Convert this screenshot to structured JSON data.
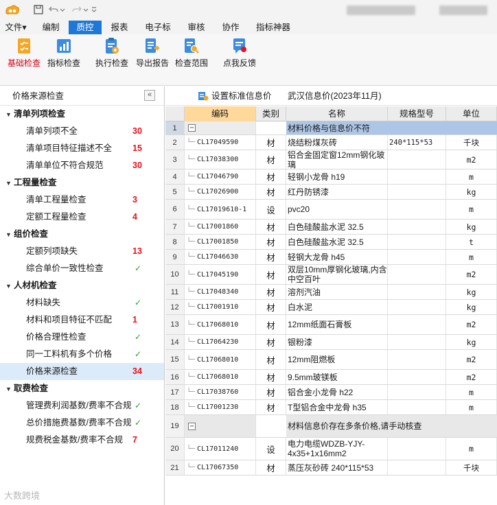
{
  "menu": {
    "items": [
      "文件▾",
      "编制",
      "质控",
      "报表",
      "电子标",
      "审核",
      "协作",
      "指标神器"
    ],
    "active_index": 2
  },
  "ribbon": {
    "buttons": [
      {
        "label": "基础检查",
        "icon": "checklist-icon",
        "color": "#d0021b"
      },
      {
        "label": "指标检查",
        "icon": "bar-chart-icon"
      },
      {
        "label": "执行检查",
        "icon": "clipboard-gear-icon"
      },
      {
        "label": "导出报告",
        "icon": "export-report-icon"
      },
      {
        "label": "检查范围",
        "icon": "search-doc-icon"
      },
      {
        "label": "点我反馈",
        "icon": "feedback-icon"
      }
    ]
  },
  "left_panel": {
    "title": "价格来源检查",
    "collapse_glyph": "«",
    "groups": [
      {
        "label": "清单列项检查",
        "items": [
          {
            "label": "清单列项不全",
            "count": "30"
          },
          {
            "label": "清单项目特征描述不全",
            "count": "15"
          },
          {
            "label": "清单单位不符合规范",
            "count": "30"
          }
        ]
      },
      {
        "label": "工程量检查",
        "items": [
          {
            "label": "清单工程量检查",
            "count": "3"
          },
          {
            "label": "定额工程量检查",
            "count": "4"
          }
        ]
      },
      {
        "label": "组价检查",
        "items": [
          {
            "label": "定额列项缺失",
            "count": "13"
          },
          {
            "label": "综合单价一致性检查",
            "count": "✓"
          }
        ]
      },
      {
        "label": "人材机检查",
        "items": [
          {
            "label": "材料缺失",
            "count": "✓"
          },
          {
            "label": "材料和项目特征不匹配",
            "count": "1"
          },
          {
            "label": "价格合理性检查",
            "count": "✓"
          },
          {
            "label": "同一工料机有多个价格",
            "count": "✓"
          },
          {
            "label": "价格来源检查",
            "count": "34",
            "selected": true
          }
        ]
      },
      {
        "label": "取费检查",
        "items": [
          {
            "label": "管理费利润基数/费率不合规",
            "count": "✓"
          },
          {
            "label": "总价措施费基数/费率不合规",
            "count": "✓"
          },
          {
            "label": "规费税金基数/费率不合规",
            "count": "7"
          }
        ]
      }
    ]
  },
  "right_panel": {
    "set_button": "设置标准信息价",
    "price_source": "武汉信息价(2023年11月)",
    "columns": {
      "code": "编码",
      "type": "类别",
      "name": "名称",
      "spec": "规格型号",
      "unit": "单位"
    },
    "rows": [
      {
        "no": "1",
        "group": true,
        "title": "材料价格与信息价不符",
        "style": "g1"
      },
      {
        "no": "2",
        "code": "CL17049590",
        "type": "材",
        "name": "烧结粉煤灰砖",
        "spec": "240*115*53",
        "unit": "千块"
      },
      {
        "no": "3",
        "code": "CL17038300",
        "type": "材",
        "name": "铝合金固定窗12mm钢化玻璃",
        "spec": "",
        "unit": "m2"
      },
      {
        "no": "4",
        "code": "CL17046790",
        "type": "材",
        "name": "轻钢小龙骨 h19",
        "spec": "",
        "unit": "m"
      },
      {
        "no": "5",
        "code": "CL17026900",
        "type": "材",
        "name": "红丹防锈漆",
        "spec": "",
        "unit": "kg"
      },
      {
        "no": "6",
        "code": "CL17019610-1",
        "type": "设",
        "name": "pvc20",
        "spec": "",
        "unit": "m"
      },
      {
        "no": "7",
        "code": "CL17001860",
        "type": "材",
        "name": "白色硅酸盐水泥 32.5",
        "spec": "",
        "unit": "kg"
      },
      {
        "no": "8",
        "code": "CL17001850",
        "type": "材",
        "name": "白色硅酸盐水泥 32.5",
        "spec": "",
        "unit": "t"
      },
      {
        "no": "9",
        "code": "CL17046630",
        "type": "材",
        "name": "轻钢大龙骨 h45",
        "spec": "",
        "unit": "m"
      },
      {
        "no": "10",
        "code": "CL17045190",
        "type": "材",
        "name": "双层10mm厚钢化玻璃,内含中空百叶",
        "spec": "",
        "unit": "m2"
      },
      {
        "no": "11",
        "code": "CL17048340",
        "type": "材",
        "name": "溶剂汽油",
        "spec": "",
        "unit": "kg"
      },
      {
        "no": "12",
        "code": "CL17001910",
        "type": "材",
        "name": "白水泥",
        "spec": "",
        "unit": "kg"
      },
      {
        "no": "13",
        "code": "CL17068010",
        "type": "材",
        "name": "12mm纸面石膏板",
        "spec": "",
        "unit": "m2"
      },
      {
        "no": "14",
        "code": "CL17064230",
        "type": "材",
        "name": "银粉漆",
        "spec": "",
        "unit": "kg"
      },
      {
        "no": "15",
        "code": "CL17068010",
        "type": "材",
        "name": "12mm阻燃板",
        "spec": "",
        "unit": "m2"
      },
      {
        "no": "16",
        "code": "CL17068010",
        "type": "材",
        "name": "9.5mm玻镁板",
        "spec": "",
        "unit": "m2"
      },
      {
        "no": "17",
        "code": "CL17038760",
        "type": "材",
        "name": "铝合金小龙骨 h22",
        "spec": "",
        "unit": "m"
      },
      {
        "no": "18",
        "code": "CL17001230",
        "type": "材",
        "name": "T型铝合金中龙骨 h35",
        "spec": "",
        "unit": "m"
      },
      {
        "no": "19",
        "group": true,
        "title": "材料信息价存在多条价格,请手动核查",
        "style": "g2"
      },
      {
        "no": "20",
        "code": "CL17011240",
        "type": "设",
        "name": "电力电缆WDZB-YJY-4x35+1x16mm2",
        "spec": "",
        "unit": "m"
      },
      {
        "no": "21",
        "code": "CL17067350",
        "type": "材",
        "name": "蒸压灰砂砖 240*115*53",
        "spec": "",
        "unit": "千块"
      }
    ]
  },
  "watermark": "大数跨境",
  "colors": {
    "accent": "#1e78d7",
    "count_red": "#e8101a",
    "ok_green": "#2ca02c",
    "selected_row": "#aec6e6",
    "code_header": "#ffd89a"
  }
}
